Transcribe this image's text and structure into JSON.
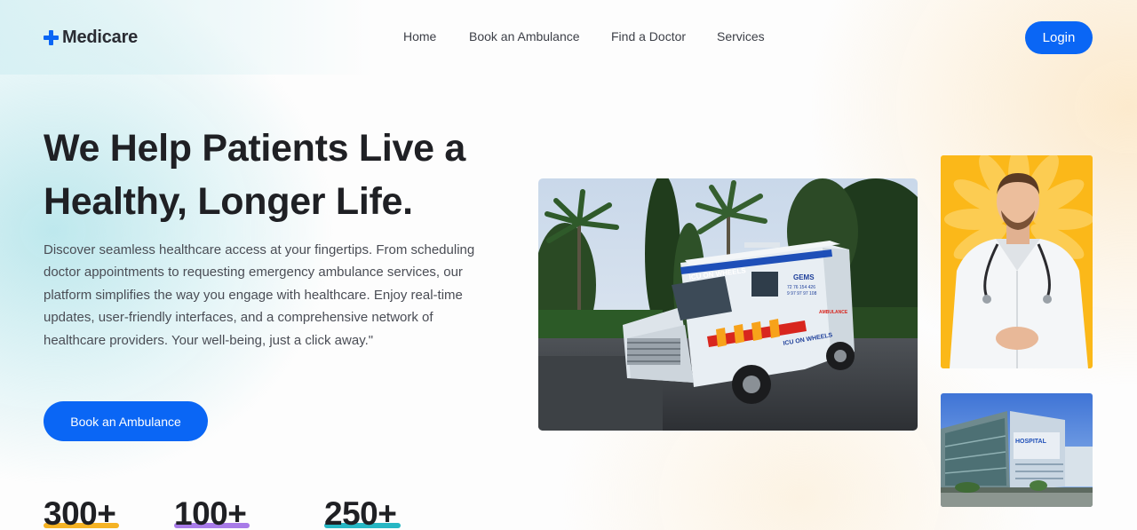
{
  "brand": {
    "name": "Medicare",
    "accent": "#0a66f5"
  },
  "nav": {
    "items": [
      {
        "label": "Home"
      },
      {
        "label": "Book an Ambulance"
      },
      {
        "label": "Find a Doctor"
      },
      {
        "label": "Services"
      }
    ]
  },
  "header": {
    "login_label": "Login"
  },
  "hero": {
    "title_line1": "We Help Patients Live a",
    "title_line2": "Healthy, Longer Life.",
    "description": "Discover seamless healthcare access at your fingertips. From scheduling doctor appointments to requesting emergency ambulance services, our platform simplifies the way you engage with healthcare. Enjoy real-time updates, user-friendly interfaces, and a comprehensive network of healthcare providers. Your well-being, just a click away.\"",
    "cta_label": "Book an Ambulance"
  },
  "stats": [
    {
      "value": "300+",
      "color": "#f5b324"
    },
    {
      "value": "100+",
      "color": "#a87be8"
    },
    {
      "value": "250+",
      "color": "#27b7c4"
    }
  ],
  "images": {
    "ambulance": {
      "texts": {
        "side": "ICU ON WHEELS",
        "brand": "GEMS",
        "phone1": "72 76 154 426",
        "phone2": "9 97 97 97 108",
        "type": "AMBULANCE",
        "rear": "ICU ON WHEELS"
      }
    },
    "hospital": {
      "sign": "HOSPITAL"
    }
  }
}
